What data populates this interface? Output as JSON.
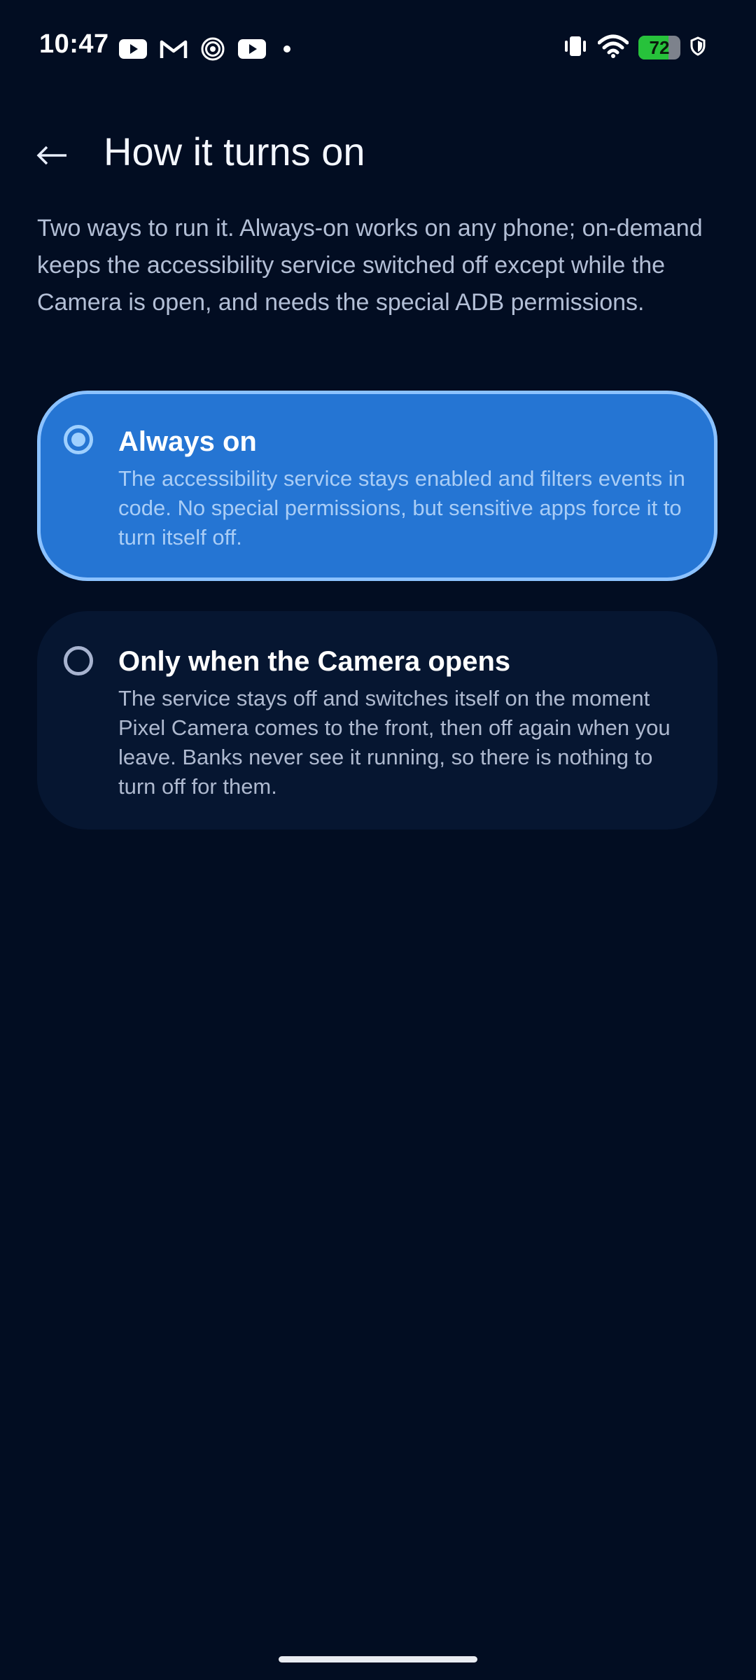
{
  "status_bar": {
    "time": "10:47",
    "notification_icons": [
      "youtube-icon",
      "gmail-icon",
      "spiral-app-icon",
      "youtube-icon",
      "more-notifications-dot-icon"
    ],
    "system_icons": [
      "vibrate-icon",
      "wifi-icon",
      "battery-icon",
      "shield-icon"
    ],
    "battery_level": "72",
    "battery_fraction": 0.72,
    "battery_color": "#27c23b"
  },
  "header": {
    "back_icon": "back-arrow-icon",
    "title": "How it turns on"
  },
  "description": "Two ways to run it. Always-on works on any phone; on-demand keeps the accessibility service switched off except while the Camera is open, and needs the special ADB permissions.",
  "options": [
    {
      "title": "Always on",
      "description": "The accessibility service stays enabled and filters events in code. No special permissions, but sensitive apps force it to turn itself off.",
      "selected": true
    },
    {
      "title": "Only when the Camera opens",
      "description": "The service stays off and switches itself on the moment Pixel Camera comes to the front, then off again when you leave. Banks never see it running, so there is nothing to turn off for them.",
      "selected": false
    }
  ],
  "colors": {
    "background": "#020d22",
    "selected_card": "#2575d3",
    "selected_border": "#8cc2ff",
    "unselected_card": "#061631"
  }
}
